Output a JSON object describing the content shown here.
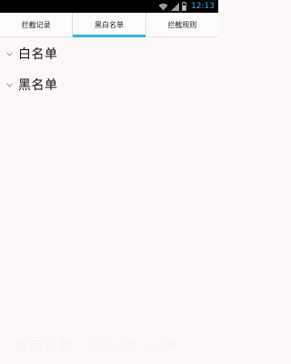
{
  "status_bar": {
    "time": "12:13",
    "icons": [
      "wifi-icon",
      "signal-icon",
      "battery-icon"
    ],
    "accent_color": "#33b5e5"
  },
  "tabs": [
    {
      "label": "拦截记录",
      "active": false
    },
    {
      "label": "黑白名单",
      "active": true
    },
    {
      "label": "拦截规则",
      "active": false
    }
  ],
  "groups": [
    {
      "label": "白名单",
      "icon": "chevron-down-icon"
    },
    {
      "label": "黑名单",
      "icon": "chevron-down-icon"
    }
  ],
  "watermark": "新浪手游 · 9XIXIN.COM"
}
